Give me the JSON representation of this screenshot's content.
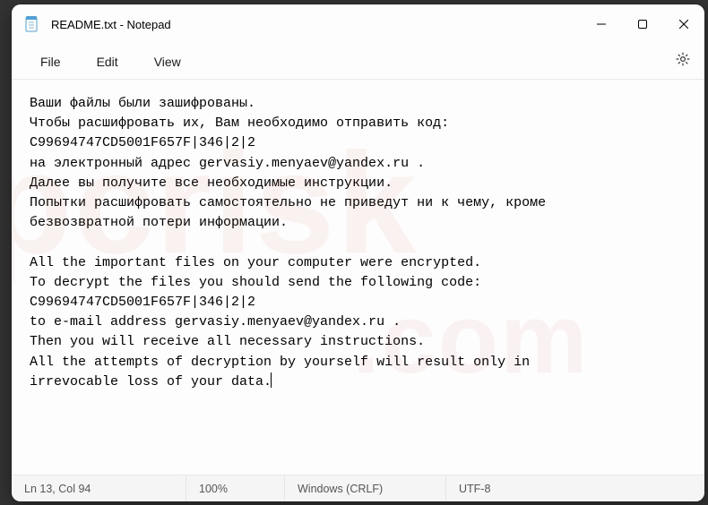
{
  "window": {
    "title": "README.txt - Notepad"
  },
  "menu": {
    "file": "File",
    "edit": "Edit",
    "view": "View"
  },
  "content": {
    "text": "Ваши файлы были зашифрованы.\nЧтобы расшифровать их, Вам необходимо отправить код:\nC99694747CD5001F657F|346|2|2\nна электронный адрес gervasiy.menyaev@yandex.ru .\nДалее вы получите все необходимые инструкции.\nПопытки расшифровать самостоятельно не приведут ни к чему, кроме\nбезвозвратной потери информации.\n\nAll the important files on your computer were encrypted.\nTo decrypt the files you should send the following code:\nC99694747CD5001F657F|346|2|2\nto e-mail address gervasiy.menyaev@yandex.ru .\nThen you will receive all necessary instructions.\nAll the attempts of decryption by yourself will result only in\nirrevocable loss of your data."
  },
  "statusbar": {
    "position": "Ln 13, Col 94",
    "zoom": "100%",
    "eol": "Windows (CRLF)",
    "encoding": "UTF-8"
  }
}
